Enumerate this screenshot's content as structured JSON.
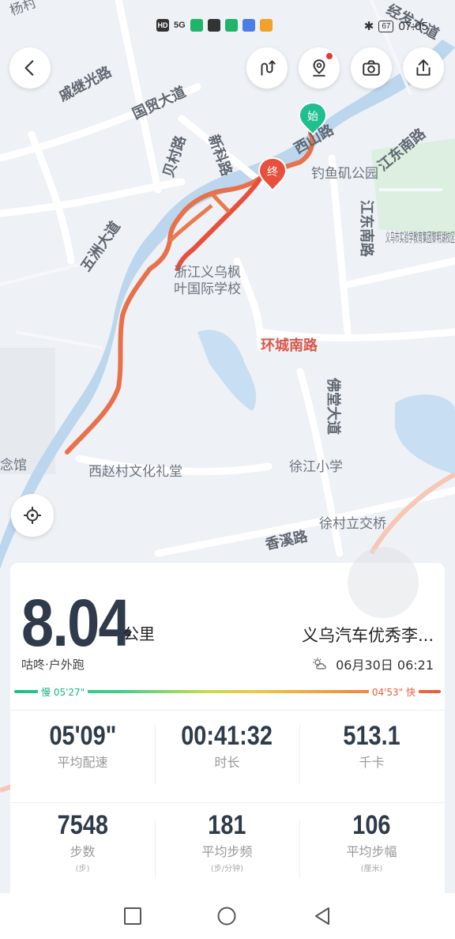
{
  "status_bar": {
    "hd": "HD",
    "signal": "5G",
    "battery": "67",
    "time": "07:05"
  },
  "map": {
    "labels": {
      "yang_cun": "杨村",
      "weijiguang_road": "戚继光路",
      "guomao_avenue": "国贸大道",
      "beicun_road": "贝村路",
      "xinke_road": "新科路",
      "xishan_road": "西山路",
      "jiangdong_south_road_ne": "江东南路",
      "diaoyuji_park": "钓鱼矶公园",
      "wuzhou_avenue": "五洲大道",
      "jiangdong_south_road": "江东南路",
      "yiwu_experimental_school": "义乌市实验学教育集团黎明湖校区",
      "fengye_school_line1": "浙江义乌枫",
      "fengye_school_line2": "叶国际学校",
      "ring_south_road": "环城南路",
      "fotang_avenue": "佛堂大道",
      "memorial_hall": "念馆",
      "xizhao_hall": "西赵村文化礼堂",
      "xujiang_primary": "徐江小学",
      "xiangxi_road": "香溪路",
      "xucun_bridge": "徐村立交桥",
      "jingfa_avenue": "经发大道"
    },
    "markers": {
      "start": "始",
      "end": "终"
    }
  },
  "top_buttons": {
    "back": "back-icon",
    "route": "route-switch-icon",
    "location_pin": "location-person-icon",
    "camera": "camera-icon",
    "share": "share-icon"
  },
  "summary": {
    "distance": "8.04",
    "distance_unit": "公里",
    "route_name": "义乌汽车优秀李...",
    "activity_type": "咕咚·户外跑",
    "date_time": "06月30日 06:21",
    "pace_slow_label": "慢 05'27\"",
    "pace_fast_label": "04'53\" 快"
  },
  "stats_row1": [
    {
      "value": "05'09\"",
      "label": "平均配速"
    },
    {
      "value": "00:41:32",
      "label": "时长"
    },
    {
      "value": "513.1",
      "label": "千卡"
    }
  ],
  "stats_row2": [
    {
      "value": "7548",
      "label": "步数",
      "unit": "(步)"
    },
    {
      "value": "181",
      "label": "平均步频",
      "unit": "(步/分钟)"
    },
    {
      "value": "106",
      "label": "平均步幅",
      "unit": "(厘米)"
    }
  ],
  "colors": {
    "route_start": "#e8704a",
    "route_end": "#e6503c",
    "start_marker": "#1fbf8f",
    "end_marker": "#e6503c",
    "river": "#bcd6ee"
  }
}
